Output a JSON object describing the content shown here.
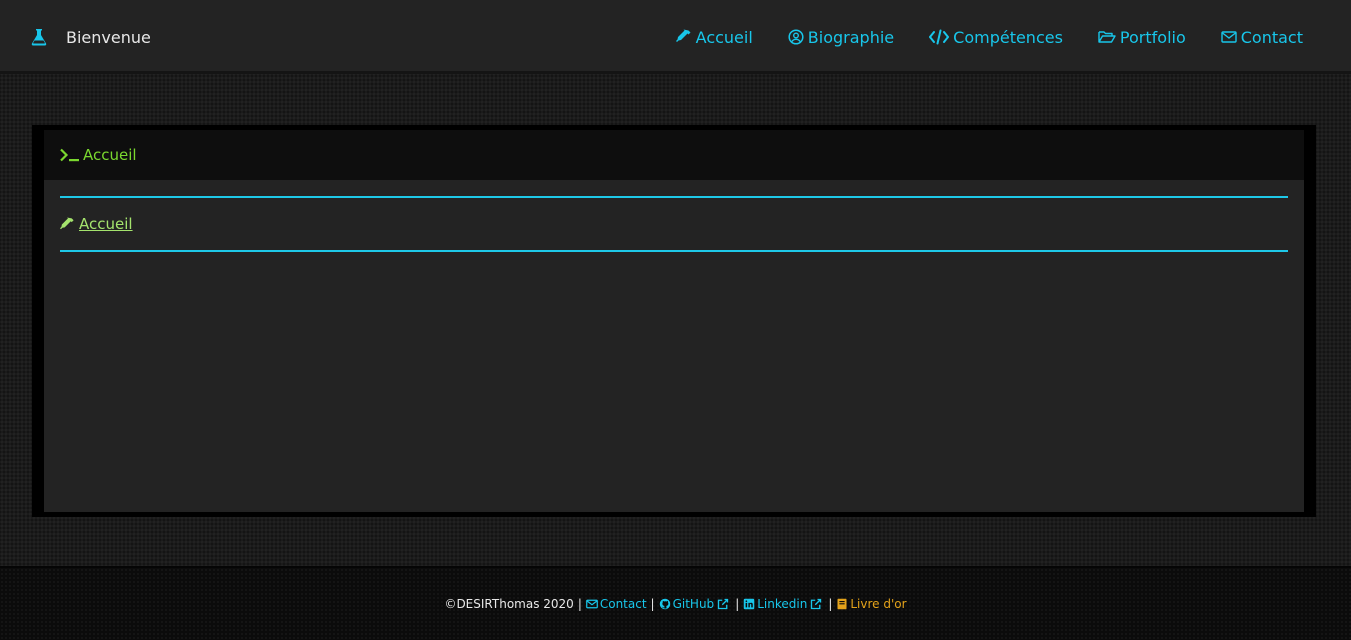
{
  "navbar": {
    "brand": {
      "label": "Bienvenue",
      "icon": "flask-icon"
    },
    "links": [
      {
        "label": "Accueil",
        "icon": "eyedropper-icon"
      },
      {
        "label": "Biographie",
        "icon": "user-circle-icon"
      },
      {
        "label": "Compétences",
        "icon": "code-icon"
      },
      {
        "label": "Portfolio",
        "icon": "folder-open-icon"
      },
      {
        "label": "Contact",
        "icon": "envelope-icon"
      }
    ]
  },
  "panel": {
    "title": "Accueil",
    "title_icon": "terminal-icon",
    "section_link": "Accueil",
    "section_icon": "eyedropper-icon"
  },
  "footer": {
    "copyright": "©DESIRThomas 2020",
    "separator": "|",
    "contact": "Contact",
    "github": "GitHub",
    "linkedin": "Linkedin",
    "guestbook": "Livre d'or"
  },
  "colors": {
    "accent_cyan": "#18c6ea",
    "accent_green": "#7ad82f",
    "accent_gold": "#e3a21a"
  }
}
